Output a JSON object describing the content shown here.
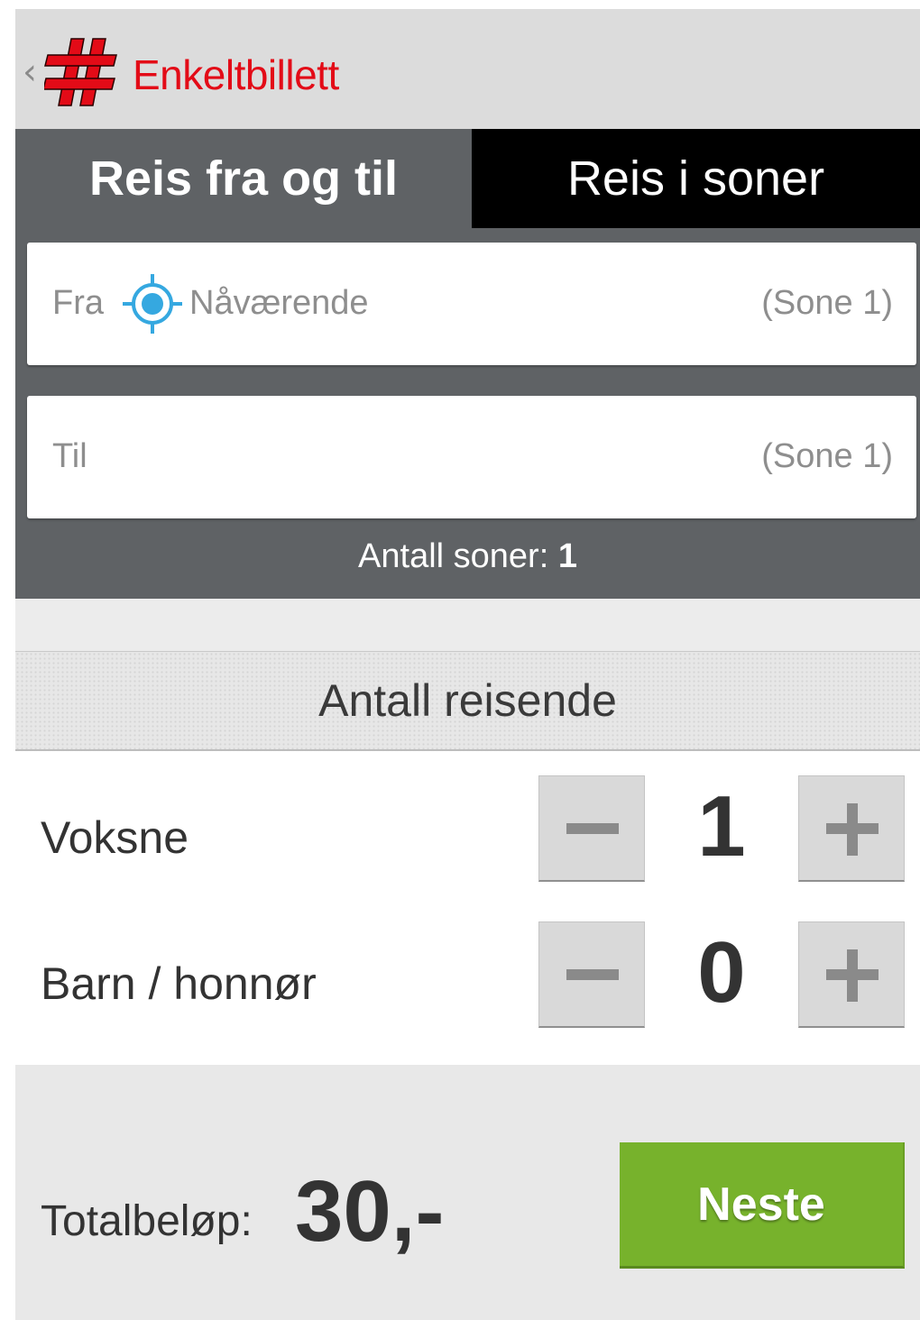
{
  "header": {
    "up_caret": "‹",
    "title": "Enkeltbillett",
    "brand_color": "#e30b17"
  },
  "tabs": [
    {
      "label": "Reis fra og til",
      "selected": true
    },
    {
      "label": "Reis i soner",
      "selected": false
    }
  ],
  "route": {
    "from": {
      "label": "Fra",
      "value": "Nåværende",
      "zone": "(Sone 1)",
      "icon": "location-target-icon"
    },
    "to": {
      "label": "Til",
      "zone": "(Sone 1)"
    },
    "zone_count_label": "Antall soner:",
    "zone_count_value": "1"
  },
  "travelers": {
    "heading": "Antall reisende",
    "rows": [
      {
        "label": "Voksne",
        "count": "1"
      },
      {
        "label": "Barn / honnør",
        "count": "0"
      }
    ]
  },
  "footer": {
    "total_label": "Totalbeløp:",
    "total_value": "30,-",
    "next_label": "Neste",
    "accent": "#77b22c"
  }
}
